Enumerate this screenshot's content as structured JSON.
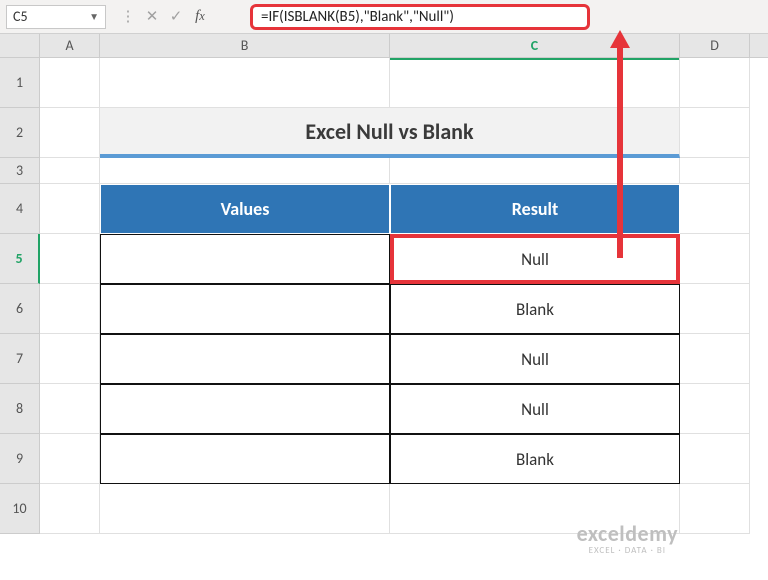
{
  "formula_bar": {
    "cell_ref": "C5",
    "formula": "=IF(ISBLANK(B5),\"Blank\",\"Null\")"
  },
  "columns": [
    "A",
    "B",
    "C",
    "D"
  ],
  "rows": [
    "1",
    "2",
    "3",
    "4",
    "5",
    "6",
    "7",
    "8",
    "9",
    "10"
  ],
  "selected_cell": "C5",
  "title": "Excel Null vs Blank",
  "table": {
    "headers": {
      "values": "Values",
      "result": "Result"
    },
    "data": [
      {
        "value": "",
        "result": "Null"
      },
      {
        "value": "",
        "result": "Blank"
      },
      {
        "value": "",
        "result": "Null"
      },
      {
        "value": "",
        "result": "Null"
      },
      {
        "value": "",
        "result": "Blank"
      }
    ]
  },
  "watermark": {
    "brand": "exceldemy",
    "tagline": "EXCEL · DATA · BI"
  },
  "colors": {
    "accent": "#2f75b5",
    "highlight": "#e6343a",
    "excel_green": "#21a366"
  }
}
